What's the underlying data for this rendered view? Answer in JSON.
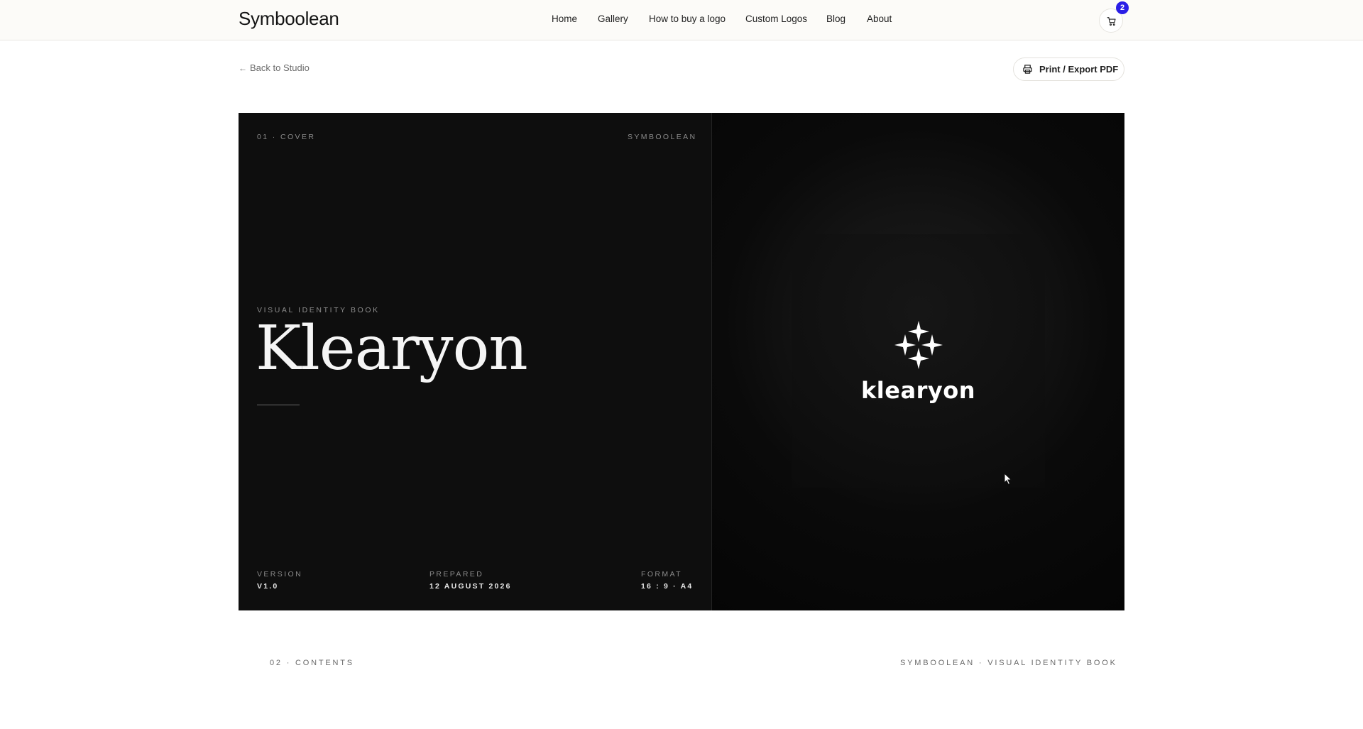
{
  "header": {
    "brand": "Symboolean",
    "nav": [
      "Home",
      "Gallery",
      "How to buy a logo",
      "Custom Logos",
      "Blog",
      "About"
    ],
    "cart_count": "2"
  },
  "toolbar": {
    "back_label": "Back to Studio",
    "print_label": "Print / Export PDF"
  },
  "cover": {
    "section": "01 · COVER",
    "publisher": "SYMBOOLEAN",
    "kicker": "VISUAL IDENTITY BOOK",
    "title": "Klearyon",
    "meta": [
      {
        "label": "VERSION",
        "value": "V1.0"
      },
      {
        "label": "PREPARED",
        "value": "12 AUGUST 2026"
      },
      {
        "label": "FORMAT",
        "value": "16 : 9 · A4"
      }
    ],
    "logo_wordmark": "klearyon",
    "logo_icon": "four-point-star-cluster-icon"
  },
  "next_page": {
    "section": "02 · CONTENTS",
    "running_title": "SYMBOOLEAN · VISUAL IDENTITY BOOK"
  },
  "colors": {
    "cover_bg": "#0e0e0e",
    "badge": "#2a1ee6",
    "header_bg": "#fcfbf8"
  }
}
